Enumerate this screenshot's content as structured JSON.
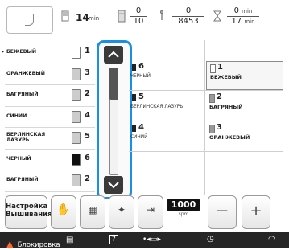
{
  "top": {
    "time_value": "14",
    "time_unit": "min",
    "color_frac_num": "0",
    "color_frac_den": "10",
    "stitch_frac_num": "0",
    "stitch_frac_den": "8453",
    "min_frac_num": "0",
    "min_frac_num_unit": "min",
    "min_frac_den": "17",
    "min_frac_den_unit": "min"
  },
  "left_list": [
    {
      "label": "БЕЖЕВЫЙ",
      "num": "1",
      "color": "#ffffff",
      "active": true
    },
    {
      "label": "ОРАНЖЕВЫЙ",
      "num": "3",
      "color": "#cccccc",
      "active": false
    },
    {
      "label": "БАГРЯНЫЙ",
      "num": "2",
      "color": "#cccccc",
      "active": false
    },
    {
      "label": "СИНИЙ",
      "num": "4",
      "color": "#cccccc",
      "active": false
    },
    {
      "label": "БЕРЛИНСКАЯ ЛАЗУРЬ",
      "num": "5",
      "color": "#cccccc",
      "active": false
    },
    {
      "label": "ЧЕРНЫЙ",
      "num": "6",
      "color": "#111111",
      "active": false
    },
    {
      "label": "БАГРЯНЫЙ",
      "num": "2",
      "color": "#cccccc",
      "active": false
    }
  ],
  "right_table": [
    {
      "left_num": "6",
      "left_label": "ЧЕРНЫЙ",
      "right_num": "1",
      "right_label": "БЕЖЕВЫЙ"
    },
    {
      "left_num": "5",
      "left_label": "БЕРЛИНСКАЯ ЛАЗУРЬ",
      "right_num": "2",
      "right_label": "БАГРЯНЫЙ"
    },
    {
      "left_num": "4",
      "left_label": "СИНИЙ",
      "right_num": "3",
      "right_label": "ОРАНЖЕВЫЙ"
    }
  ],
  "buttons": {
    "settings_label_1": "Настройка",
    "settings_label_2": "Вышивания",
    "speed_value": "1000",
    "speed_unit": "spm",
    "minus": "—",
    "plus": "+"
  },
  "status": {
    "lock_label": "Блокировка",
    "help_label": "?"
  },
  "icons": {
    "up": "up-arrow-icon",
    "down": "down-arrow-icon",
    "hand": "hand-icon",
    "lock": "lock-icon"
  },
  "colors": {
    "accent": "#1a8fe8",
    "dark": "#262626"
  }
}
